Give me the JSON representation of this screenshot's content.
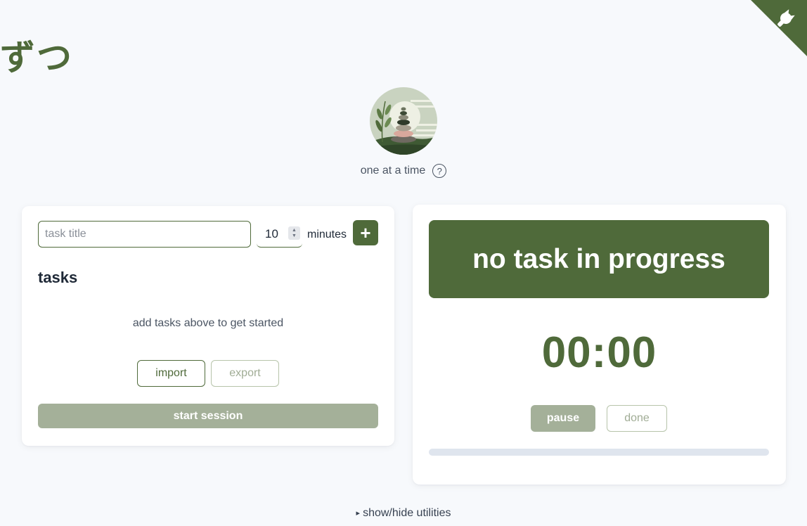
{
  "app": {
    "title": "ずつ",
    "tagline": "one at a time",
    "help_symbol": "?"
  },
  "task_form": {
    "title_placeholder": "task title",
    "minutes_value": "10",
    "minutes_label": "minutes",
    "add_symbol": "+"
  },
  "tasks": {
    "heading": "tasks",
    "empty_message": "add tasks above to get started",
    "import_label": "import",
    "export_label": "export",
    "start_label": "start session"
  },
  "current": {
    "status": "no task in progress",
    "timer": "00:00",
    "pause_label": "pause",
    "done_label": "done",
    "progress": 0
  },
  "footer": {
    "utilities_toggle": "show/hide utilities",
    "toggle_symbol": "▸"
  },
  "colors": {
    "accent": "#4f6a3a",
    "accent_muted": "#a4b099",
    "background": "#f7f9fc"
  },
  "icons": {
    "corner": "github-octocat-icon",
    "logo": "zen-stones-logo",
    "help": "question-circle-icon"
  }
}
